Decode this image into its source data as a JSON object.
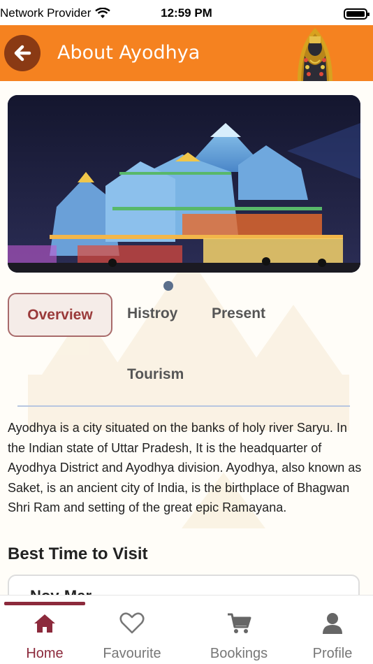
{
  "status_bar": {
    "carrier": "Network Provider",
    "time": "12:59 PM"
  },
  "header": {
    "title": "About Ayodhya",
    "back_icon": "arrow-left-icon",
    "color": "#f58220"
  },
  "tabs": [
    {
      "label": "Overview",
      "active": true
    },
    {
      "label": "Histroy",
      "active": false
    },
    {
      "label": "Present",
      "active": false
    },
    {
      "label": "Tourism",
      "active": false
    }
  ],
  "overview": {
    "text": "Ayodhya is a city situated on the banks of holy river Saryu. In the Indian state of Uttar Pradesh, It is the headquarter of Ayodhya District and Ayodhya division. Ayodhya, also known as Saket, is an ancient city of India, is the birthplace of Bhagwan Shri Ram and setting of the great epic Ramayana."
  },
  "best_time": {
    "title": "Best Time to Visit",
    "value": "Nov-Mar"
  },
  "bottom_nav": [
    {
      "label": "Home",
      "icon": "home-icon",
      "active": true
    },
    {
      "label": "Favourite",
      "icon": "heart-icon",
      "active": false
    },
    {
      "label": "Bookings",
      "icon": "cart-icon",
      "active": false
    },
    {
      "label": "Profile",
      "icon": "person-icon",
      "active": false
    }
  ],
  "colors": {
    "accent": "#f58220",
    "active_tab": "#9a3a3a",
    "active_nav": "#8c2a3c"
  }
}
